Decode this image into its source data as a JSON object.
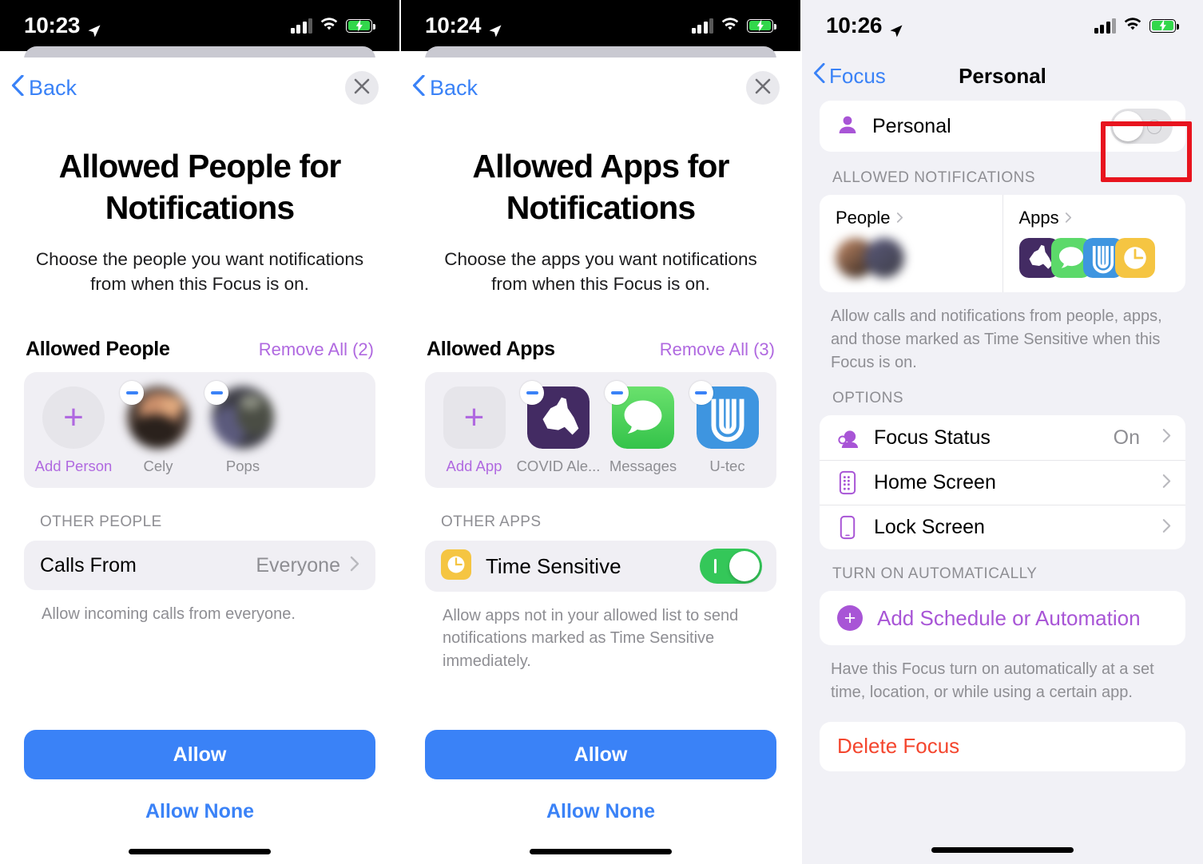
{
  "panels": {
    "people": {
      "status": {
        "time": "10:23",
        "location_icon": "location-arrow-icon",
        "signal_icon": "cellular-signal-icon",
        "wifi_icon": "wifi-icon",
        "battery_icon": "battery-charging-icon"
      },
      "nav": {
        "back": "Back",
        "close_icon": "close-icon"
      },
      "title": "Allowed People for Notifications",
      "subtitle": "Choose the people you want notifications from when this Focus is on.",
      "section": {
        "title": "Allowed People",
        "action": "Remove All (2)"
      },
      "add_tile": {
        "label": "Add Person",
        "icon": "plus-icon"
      },
      "people": [
        {
          "name": "Cely",
          "remove_icon": "minus-badge-icon"
        },
        {
          "name": "Pops",
          "remove_icon": "minus-badge-icon"
        }
      ],
      "other_caption": "OTHER PEOPLE",
      "calls_row": {
        "label": "Calls From",
        "value": "Everyone",
        "chevron_icon": "chevron-right-icon"
      },
      "footnote": "Allow incoming calls from everyone.",
      "primary_button": "Allow",
      "secondary_button": "Allow None"
    },
    "apps": {
      "status": {
        "time": "10:24",
        "location_icon": "location-arrow-icon",
        "signal_icon": "cellular-signal-icon",
        "wifi_icon": "wifi-icon",
        "battery_icon": "battery-charging-icon"
      },
      "nav": {
        "back": "Back",
        "close_icon": "close-icon"
      },
      "title": "Allowed Apps for Notifications",
      "subtitle": "Choose the apps you want notifications from when this Focus is on.",
      "section": {
        "title": "Allowed Apps",
        "action": "Remove All (3)"
      },
      "add_tile": {
        "label": "Add App",
        "icon": "plus-icon"
      },
      "apps": [
        {
          "name": "COVID Ale...",
          "icon": "covid-alert-ny-app-icon",
          "remove_icon": "minus-badge-icon"
        },
        {
          "name": "Messages",
          "icon": "messages-app-icon",
          "remove_icon": "minus-badge-icon"
        },
        {
          "name": "U-tec",
          "icon": "u-tec-app-icon",
          "remove_icon": "minus-badge-icon"
        }
      ],
      "other_caption": "OTHER APPS",
      "time_sensitive": {
        "label": "Time Sensitive",
        "icon": "clock-icon",
        "enabled": true
      },
      "footnote": "Allow apps not in your allowed list to send notifications marked as Time Sensitive immediately.",
      "primary_button": "Allow",
      "secondary_button": "Allow None"
    },
    "focus": {
      "status": {
        "time": "10:26",
        "location_icon": "location-arrow-icon",
        "signal_icon": "cellular-signal-icon",
        "wifi_icon": "wifi-icon",
        "battery_icon": "battery-charging-icon"
      },
      "nav": {
        "back": "Focus",
        "title": "Personal"
      },
      "toggle_row": {
        "label": "Personal",
        "icon": "person-icon",
        "enabled": false
      },
      "allowed_caption": "ALLOWED NOTIFICATIONS",
      "cards": [
        {
          "label": "People",
          "chevron_icon": "chevron-right-icon"
        },
        {
          "label": "Apps",
          "chevron_icon": "chevron-right-icon"
        }
      ],
      "allowed_note": "Allow calls and notifications from people, apps, and those marked as Time Sensitive when this Focus is on.",
      "options_caption": "OPTIONS",
      "options": [
        {
          "label": "Focus Status",
          "value": "On",
          "icon": "focus-status-icon"
        },
        {
          "label": "Home Screen",
          "value": "",
          "icon": "home-screen-icon"
        },
        {
          "label": "Lock Screen",
          "value": "",
          "icon": "lock-screen-icon"
        }
      ],
      "automatic_caption": "TURN ON AUTOMATICALLY",
      "add_schedule": {
        "label": "Add Schedule or Automation",
        "icon": "plus-circle-icon"
      },
      "automatic_note": "Have this Focus turn on automatically at a set time, location, or while using a certain app.",
      "delete": "Delete Focus"
    }
  },
  "annotation": {
    "type": "highlight-rectangle",
    "color": "#e8141e",
    "target": "personal-focus-toggle"
  },
  "colors": {
    "blue": "#3a82f7",
    "purple": "#b069e0",
    "green": "#34c759",
    "red": "#f4462e",
    "highlight": "#e8141e"
  }
}
